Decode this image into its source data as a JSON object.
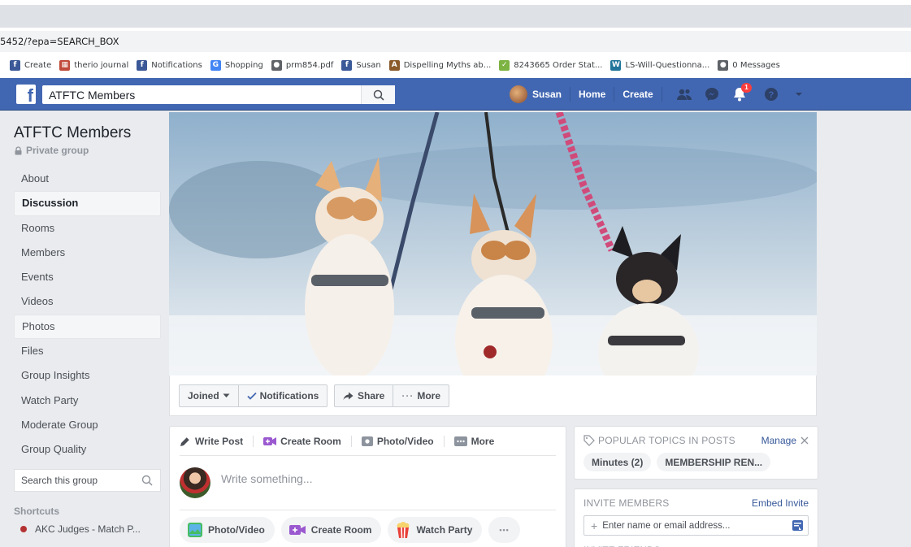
{
  "browser": {
    "url": "5452/?epa=SEARCH_BOX",
    "bookmarks": [
      {
        "label": "Create",
        "icon": "facebook-icon",
        "color": "#3b5998"
      },
      {
        "label": "therio journal",
        "icon": "journal-icon",
        "color": "#c04a3a"
      },
      {
        "label": "Notifications",
        "icon": "facebook-icon",
        "color": "#3b5998"
      },
      {
        "label": "Shopping",
        "icon": "google-icon",
        "color": "#4285f4"
      },
      {
        "label": "prm854.pdf",
        "icon": "globe-icon",
        "color": "#5f6368"
      },
      {
        "label": "Susan",
        "icon": "facebook-icon",
        "color": "#3b5998"
      },
      {
        "label": "Dispelling Myths ab...",
        "icon": "a-icon",
        "color": "#8a5a2a"
      },
      {
        "label": "8243665 Order Stat...",
        "icon": "shop-icon",
        "color": "#7cb342"
      },
      {
        "label": "LS-Will-Questionna...",
        "icon": "wordpress-icon",
        "color": "#21759b"
      },
      {
        "label": "0 Messages",
        "icon": "globe-icon",
        "color": "#5f6368"
      }
    ]
  },
  "topbar": {
    "search_value": "ATFTC Members",
    "user_name": "Susan",
    "home_label": "Home",
    "create_label": "Create",
    "notification_count": "1",
    "brand_color": "#4267b2"
  },
  "sidebar": {
    "group_name": "ATFTC Members",
    "privacy": "Private group",
    "items": [
      {
        "label": "About"
      },
      {
        "label": "Discussion"
      },
      {
        "label": "Rooms"
      },
      {
        "label": "Members"
      },
      {
        "label": "Events"
      },
      {
        "label": "Videos"
      },
      {
        "label": "Photos"
      },
      {
        "label": "Files"
      },
      {
        "label": "Group Insights"
      },
      {
        "label": "Watch Party"
      },
      {
        "label": "Moderate Group"
      },
      {
        "label": "Group Quality"
      }
    ],
    "search_placeholder": "Search this group",
    "shortcuts_heading": "Shortcuts",
    "shortcut_item": "AKC Judges - Match P..."
  },
  "actions": {
    "joined_label": "Joined",
    "notifications_label": "Notifications",
    "share_label": "Share",
    "more_label": "More"
  },
  "composer": {
    "tabs": [
      {
        "label": "Write Post"
      },
      {
        "label": "Create Room"
      },
      {
        "label": "Photo/Video"
      },
      {
        "label": "More"
      }
    ],
    "placeholder": "Write something...",
    "chips": [
      {
        "label": "Photo/Video"
      },
      {
        "label": "Create Room"
      },
      {
        "label": "Watch Party"
      }
    ],
    "more_chip": "•••"
  },
  "topics_panel": {
    "title": "POPULAR TOPICS IN POSTS",
    "manage_label": "Manage",
    "topics": [
      {
        "label": "Minutes (2)"
      },
      {
        "label": "MEMBERSHIP REN..."
      }
    ]
  },
  "invite_panel": {
    "title": "INVITE MEMBERS",
    "embed_label": "Embed Invite",
    "input_placeholder": "Enter name or email address...",
    "friends_heading": "INVITE FRIENDS"
  }
}
